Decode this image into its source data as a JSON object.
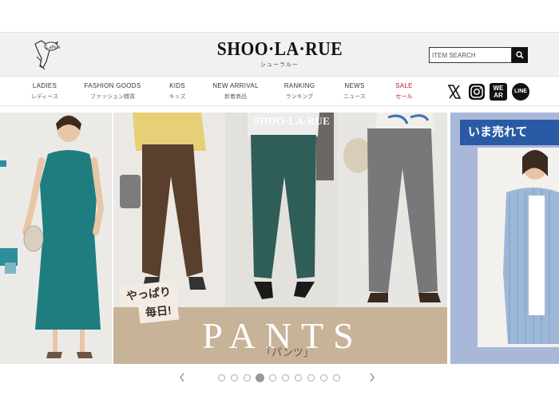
{
  "header": {
    "logo": "SHOO·LA·RUE",
    "logo_sub": "シューラルー",
    "search_placeholder": "ITEM SEARCH"
  },
  "nav": [
    {
      "en": "LADIES",
      "jp": "レディース"
    },
    {
      "en": "FASHION GOODS",
      "jp": "ファッション雑貨"
    },
    {
      "en": "KIDS",
      "jp": "キッズ"
    },
    {
      "en": "NEW ARRIVAL",
      "jp": "新着商品"
    },
    {
      "en": "RANKING",
      "jp": "ランキング"
    },
    {
      "en": "NEWS",
      "jp": "ニュース"
    },
    {
      "en": "SALE",
      "jp": "セール"
    }
  ],
  "social": [
    "x-icon",
    "instagram-icon",
    "wear-icon",
    "line-icon"
  ],
  "social_text": {
    "wear": "WEAR",
    "line": "LINE"
  },
  "carousel": {
    "main": {
      "slide_logo": "SHOO·LA·RUE",
      "badge_1": "やっぱり",
      "badge_2": "毎日!",
      "headline": "PANTS",
      "subheadline": "「パンツ」"
    },
    "right": {
      "banner": "いま売れて"
    },
    "dots_total": 10,
    "active_index": 3
  },
  "colors": {
    "sale": "#c8102e",
    "banner_blue": "#2b5aa5"
  }
}
